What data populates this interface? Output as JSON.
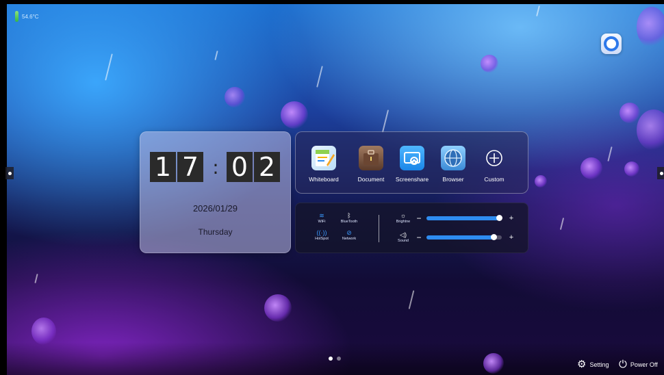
{
  "status": {
    "temperature": "54.6°C",
    "temperature_icon": "thermometer-icon"
  },
  "corner_app": {
    "icon": "circle-app-icon"
  },
  "clock": {
    "h1": "1",
    "h2": "7",
    "colon": ":",
    "m1": "0",
    "m2": "2",
    "date": "2026/01/29",
    "weekday": "Thursday"
  },
  "apps": [
    {
      "label": "Whiteboard",
      "icon": "whiteboard-icon"
    },
    {
      "label": "Document",
      "icon": "document-icon"
    },
    {
      "label": "Screenshare",
      "icon": "screenshare-icon"
    },
    {
      "label": "Browser",
      "icon": "browser-icon"
    },
    {
      "label": "Custom",
      "icon": "add-circle-icon"
    }
  ],
  "quick_settings": [
    {
      "label": "WiFi",
      "icon": "wifi-icon"
    },
    {
      "label": "BlueTooth",
      "icon": "bluetooth-icon"
    },
    {
      "label": "HotSpot",
      "icon": "hotspot-icon"
    },
    {
      "label": "Network",
      "icon": "network-icon"
    }
  ],
  "sliders": [
    {
      "label": "Brightne",
      "icon": "brightness-icon",
      "minus": "−",
      "plus": "+",
      "level": 0.97
    },
    {
      "label": "Sound",
      "icon": "volume-icon",
      "minus": "−",
      "plus": "+",
      "level": 0.9
    }
  ],
  "pager": {
    "pages": 2,
    "current": 1
  },
  "footer": {
    "setting_label": "Setting",
    "setting_icon": "gear-icon",
    "power_label": "Power Off",
    "power_icon": "power-icon"
  },
  "colors": {
    "accent": "#2e8cf0",
    "slider_fill": "#2e8cf0"
  }
}
